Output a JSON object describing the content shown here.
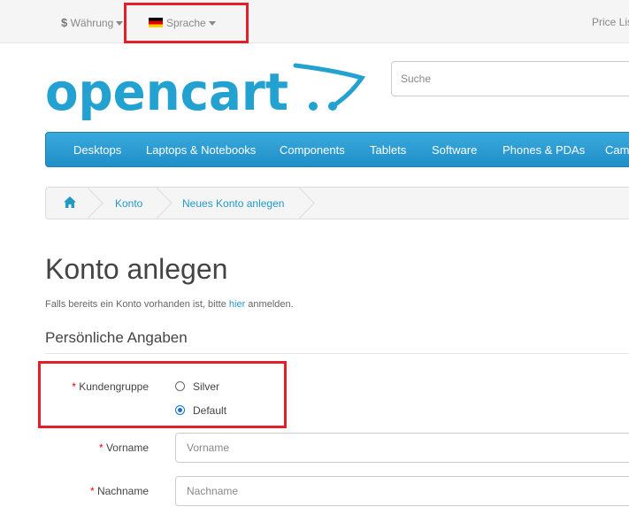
{
  "topbar": {
    "currency_symbol": "$",
    "currency_label": "Währung",
    "language_label": "Sprache",
    "price_list_label": "Price Lis"
  },
  "brand": {
    "logo_text": "opencart",
    "logo_color": "#23a1d1"
  },
  "search": {
    "placeholder": "Suche"
  },
  "nav": {
    "items": [
      "Desktops",
      "Laptops & Notebooks",
      "Components",
      "Tablets",
      "Software",
      "Phones & PDAs",
      "Came"
    ]
  },
  "breadcrumb": {
    "items": [
      "Konto",
      "Neues Konto anlegen"
    ]
  },
  "page": {
    "title": "Konto anlegen",
    "intro_before": "Falls bereits ein Konto vorhanden ist, bitte ",
    "intro_link": "hier",
    "intro_after": " anmelden."
  },
  "section": {
    "legend": "Persönliche Angaben"
  },
  "form": {
    "required_mark": "*",
    "customer_group_label": "Kundengruppe",
    "customer_group_options": [
      {
        "label": "Silver",
        "checked": false
      },
      {
        "label": "Default",
        "checked": true
      }
    ],
    "firstname_label": "Vorname",
    "firstname_placeholder": "Vorname",
    "lastname_label": "Nachname",
    "lastname_placeholder": "Nachname"
  },
  "colors": {
    "accent": "#229ac8",
    "nav": "#2aa3d6",
    "highlight": "#e3202a",
    "required": "#ff0000"
  }
}
